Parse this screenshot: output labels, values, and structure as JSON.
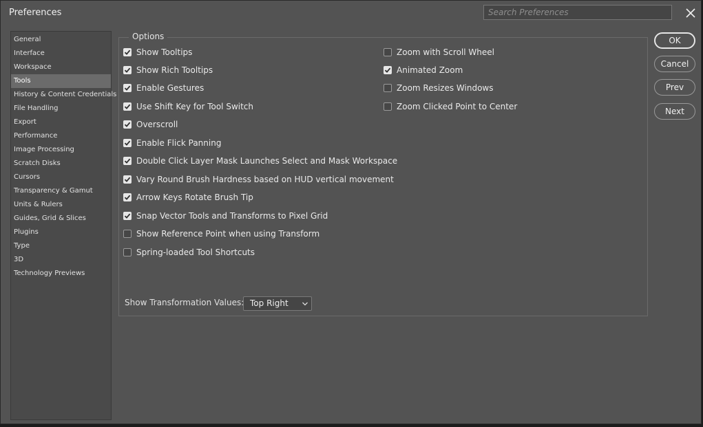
{
  "window": {
    "title": "Preferences",
    "close_icon": "close-icon"
  },
  "search": {
    "placeholder": "Search Preferences",
    "value": ""
  },
  "sidebar": {
    "selected": "Tools",
    "items": [
      {
        "label": "General"
      },
      {
        "label": "Interface"
      },
      {
        "label": "Workspace"
      },
      {
        "label": "Tools"
      },
      {
        "label": "History & Content Credentials"
      },
      {
        "label": "File Handling"
      },
      {
        "label": "Export"
      },
      {
        "label": "Performance"
      },
      {
        "label": "Image Processing"
      },
      {
        "label": "Scratch Disks"
      },
      {
        "label": "Cursors"
      },
      {
        "label": "Transparency & Gamut"
      },
      {
        "label": "Units & Rulers"
      },
      {
        "label": "Guides, Grid & Slices"
      },
      {
        "label": "Plugins"
      },
      {
        "label": "Type"
      },
      {
        "label": "3D"
      },
      {
        "label": "Technology Previews"
      }
    ]
  },
  "options": {
    "group_label": "Options",
    "left": [
      {
        "label": "Show Tooltips",
        "checked": true
      },
      {
        "label": "Show Rich Tooltips",
        "checked": true
      },
      {
        "label": "Enable Gestures",
        "checked": true
      },
      {
        "label": "Use Shift Key for Tool Switch",
        "checked": true
      },
      {
        "label": "Overscroll",
        "checked": true
      },
      {
        "label": "Enable Flick Panning",
        "checked": true
      },
      {
        "label": "Double Click Layer Mask Launches Select and Mask Workspace",
        "checked": true
      },
      {
        "label": "Vary Round Brush Hardness based on HUD vertical movement",
        "checked": true
      },
      {
        "label": "Arrow Keys Rotate Brush Tip",
        "checked": true
      },
      {
        "label": "Snap Vector Tools and Transforms to Pixel Grid",
        "checked": true
      },
      {
        "label": "Show Reference Point when using Transform",
        "checked": false
      },
      {
        "label": "Spring-loaded Tool Shortcuts",
        "checked": false
      }
    ],
    "right": [
      {
        "label": "Zoom with Scroll Wheel",
        "checked": false
      },
      {
        "label": "Animated Zoom",
        "checked": true
      },
      {
        "label": "Zoom Resizes Windows",
        "checked": false
      },
      {
        "label": "Zoom Clicked Point to Center",
        "checked": false
      }
    ]
  },
  "transformation": {
    "label": "Show Transformation Values:",
    "value": "Top Right",
    "chevron_icon": "chevron-down-icon"
  },
  "buttons": {
    "ok": "OK",
    "cancel": "Cancel",
    "prev": "Prev",
    "next": "Next"
  },
  "colors": {
    "dialog_bg": "#535353",
    "sidebar_bg": "#4a4a4a",
    "selected_bg": "#6b6b6b",
    "text": "#e6e6e6"
  }
}
